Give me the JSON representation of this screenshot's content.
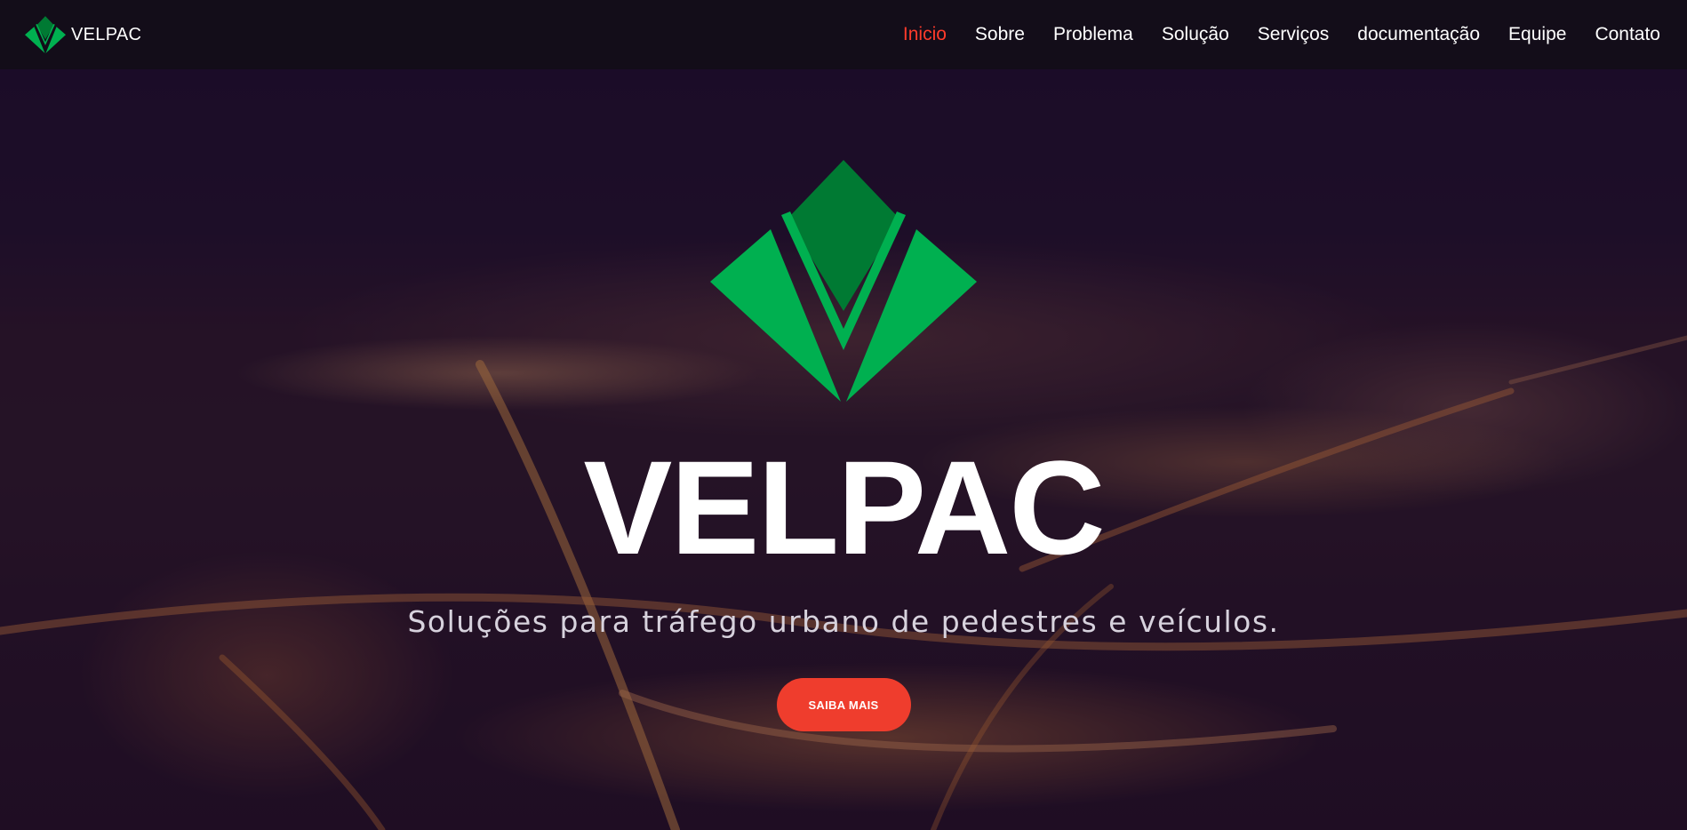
{
  "navbar": {
    "brand_name": "VELPAC",
    "links": [
      {
        "label": "Inicio",
        "active": true
      },
      {
        "label": "Sobre"
      },
      {
        "label": "Problema"
      },
      {
        "label": "Solução"
      },
      {
        "label": "Serviços"
      },
      {
        "label": "documentação"
      },
      {
        "label": "Equipe"
      },
      {
        "label": "Contato"
      }
    ]
  },
  "hero": {
    "logo_icon": "velpac-diamond-logo-icon",
    "title": "VELPAC",
    "subtitle": "Soluções para tráfego urbano de pedestres e veículos.",
    "cta_label": "SAIBA MAIS",
    "background": "night-city-aerial-image"
  },
  "colors": {
    "accent": "#ef3d2d",
    "active_link": "#ff3b2b",
    "logo_green": "#00b050",
    "logo_dark_green": "#007a33",
    "navbar_bg": "#120e18"
  }
}
